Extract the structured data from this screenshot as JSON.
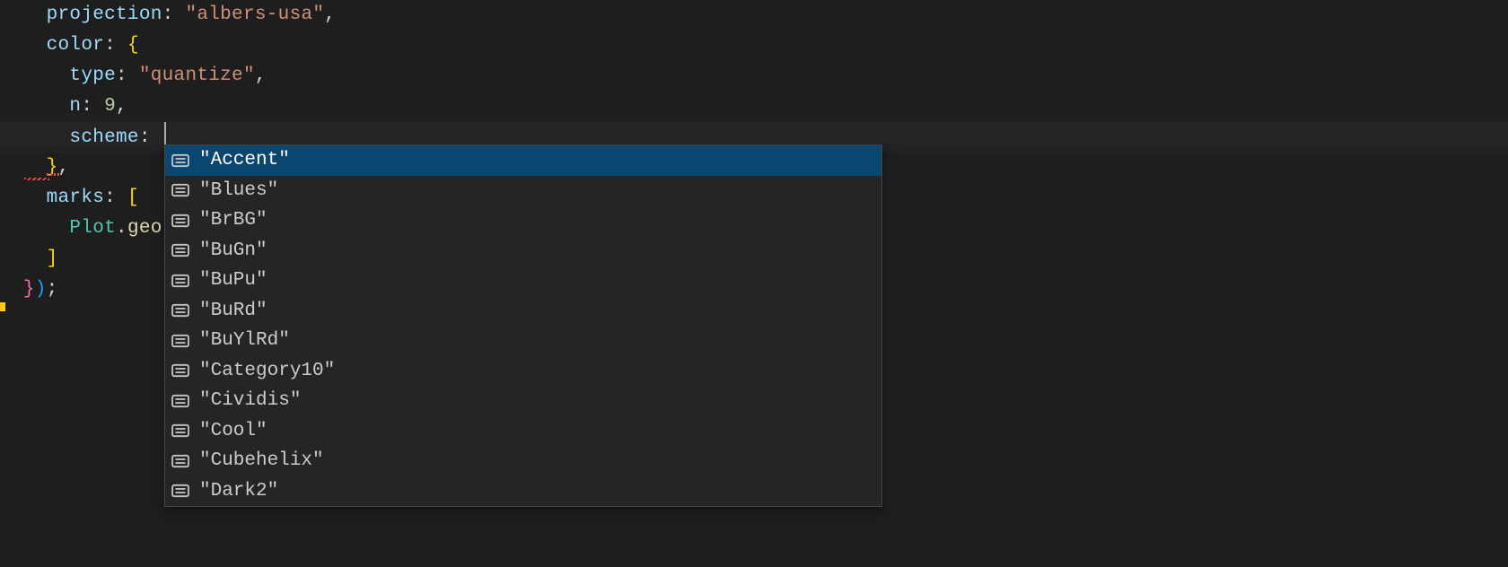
{
  "code": {
    "line1_projection_key": "projection",
    "line1_projection_value": "\"albers-usa\"",
    "line2_color_key": "color",
    "line3_type_key": "type",
    "line3_type_value": "\"quantize\"",
    "line4_n_key": "n",
    "line4_n_value": "9",
    "line5_scheme_key": "scheme",
    "line7_marks_key": "marks",
    "line8_plot_var": "Plot",
    "line8_plot_method": "geo"
  },
  "autocomplete": {
    "items": [
      {
        "label": "\"Accent\"",
        "selected": true
      },
      {
        "label": "\"Blues\"",
        "selected": false
      },
      {
        "label": "\"BrBG\"",
        "selected": false
      },
      {
        "label": "\"BuGn\"",
        "selected": false
      },
      {
        "label": "\"BuPu\"",
        "selected": false
      },
      {
        "label": "\"BuRd\"",
        "selected": false
      },
      {
        "label": "\"BuYlRd\"",
        "selected": false
      },
      {
        "label": "\"Category10\"",
        "selected": false
      },
      {
        "label": "\"Cividis\"",
        "selected": false
      },
      {
        "label": "\"Cool\"",
        "selected": false
      },
      {
        "label": "\"Cubehelix\"",
        "selected": false
      },
      {
        "label": "\"Dark2\"",
        "selected": false
      }
    ]
  }
}
